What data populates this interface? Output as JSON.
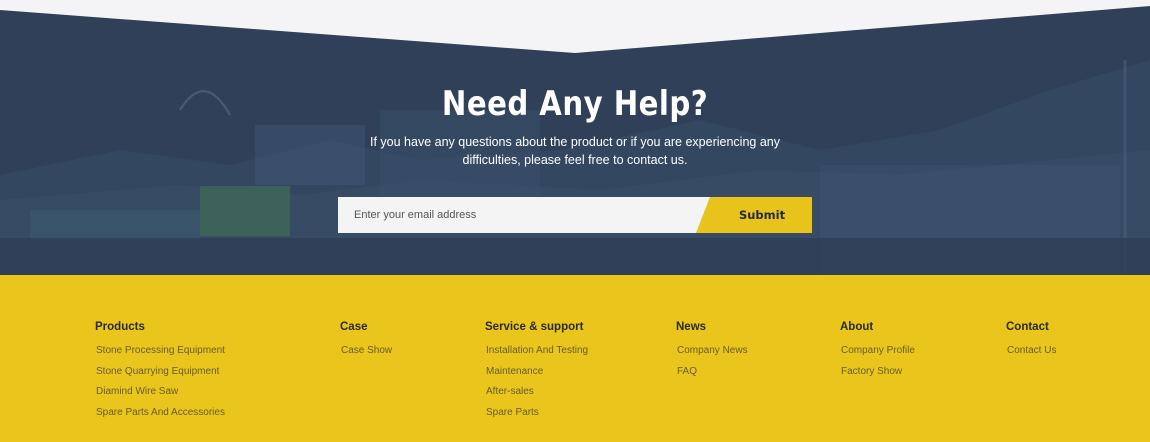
{
  "help": {
    "title": "Need Any Help?",
    "description": "If you have any questions about the product or if you are experiencing any difficulties, please feel free to contact us.",
    "email_placeholder": "Enter your email address",
    "submit_label": "Submit"
  },
  "footer": {
    "columns": [
      {
        "title": "Products",
        "links": [
          "Stone Processing Equipment",
          "Stone Quarrying Equipment",
          "Diamind Wire Saw",
          "Spare Parts And Accessories"
        ]
      },
      {
        "title": "Case",
        "links": [
          "Case Show"
        ]
      },
      {
        "title": "Service & support",
        "links": [
          "Installation And Testing",
          "Maintenance",
          "After-sales",
          "Spare Parts"
        ]
      },
      {
        "title": "News",
        "links": [
          "Company News",
          "FAQ"
        ]
      },
      {
        "title": "About",
        "links": [
          "Company Profile",
          "Factory Show"
        ]
      },
      {
        "title": "Contact",
        "links": [
          "Contact Us"
        ]
      }
    ]
  },
  "colors": {
    "navy_overlay": "#2f4058",
    "accent_yellow": "#eac61c",
    "input_bg": "#f4f4f5",
    "top_band": "#f4f4f6"
  }
}
